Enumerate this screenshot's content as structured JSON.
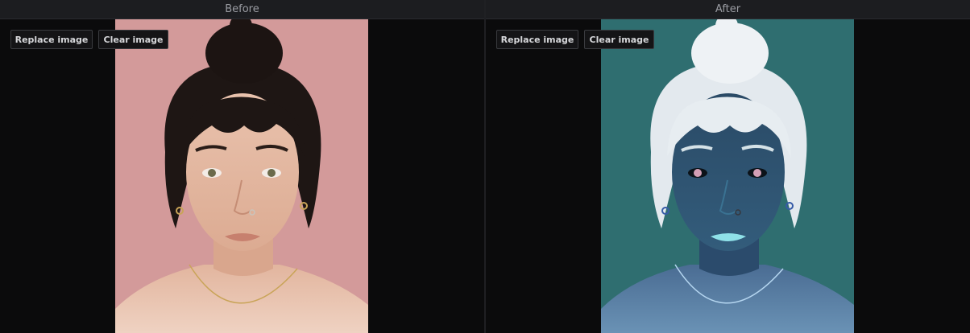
{
  "panes": [
    {
      "title": "Before",
      "replace_label": "Replace image",
      "clear_label": "Clear image",
      "image_alt": "Original portrait photo"
    },
    {
      "title": "After",
      "replace_label": "Replace image",
      "clear_label": "Clear image",
      "image_alt": "Color-inverted portrait photo"
    }
  ],
  "colors": {
    "background": "#0b0b0c",
    "header": "#1c1d20",
    "before_backdrop": "#d39a9a",
    "after_backdrop": "#2f6e70"
  }
}
